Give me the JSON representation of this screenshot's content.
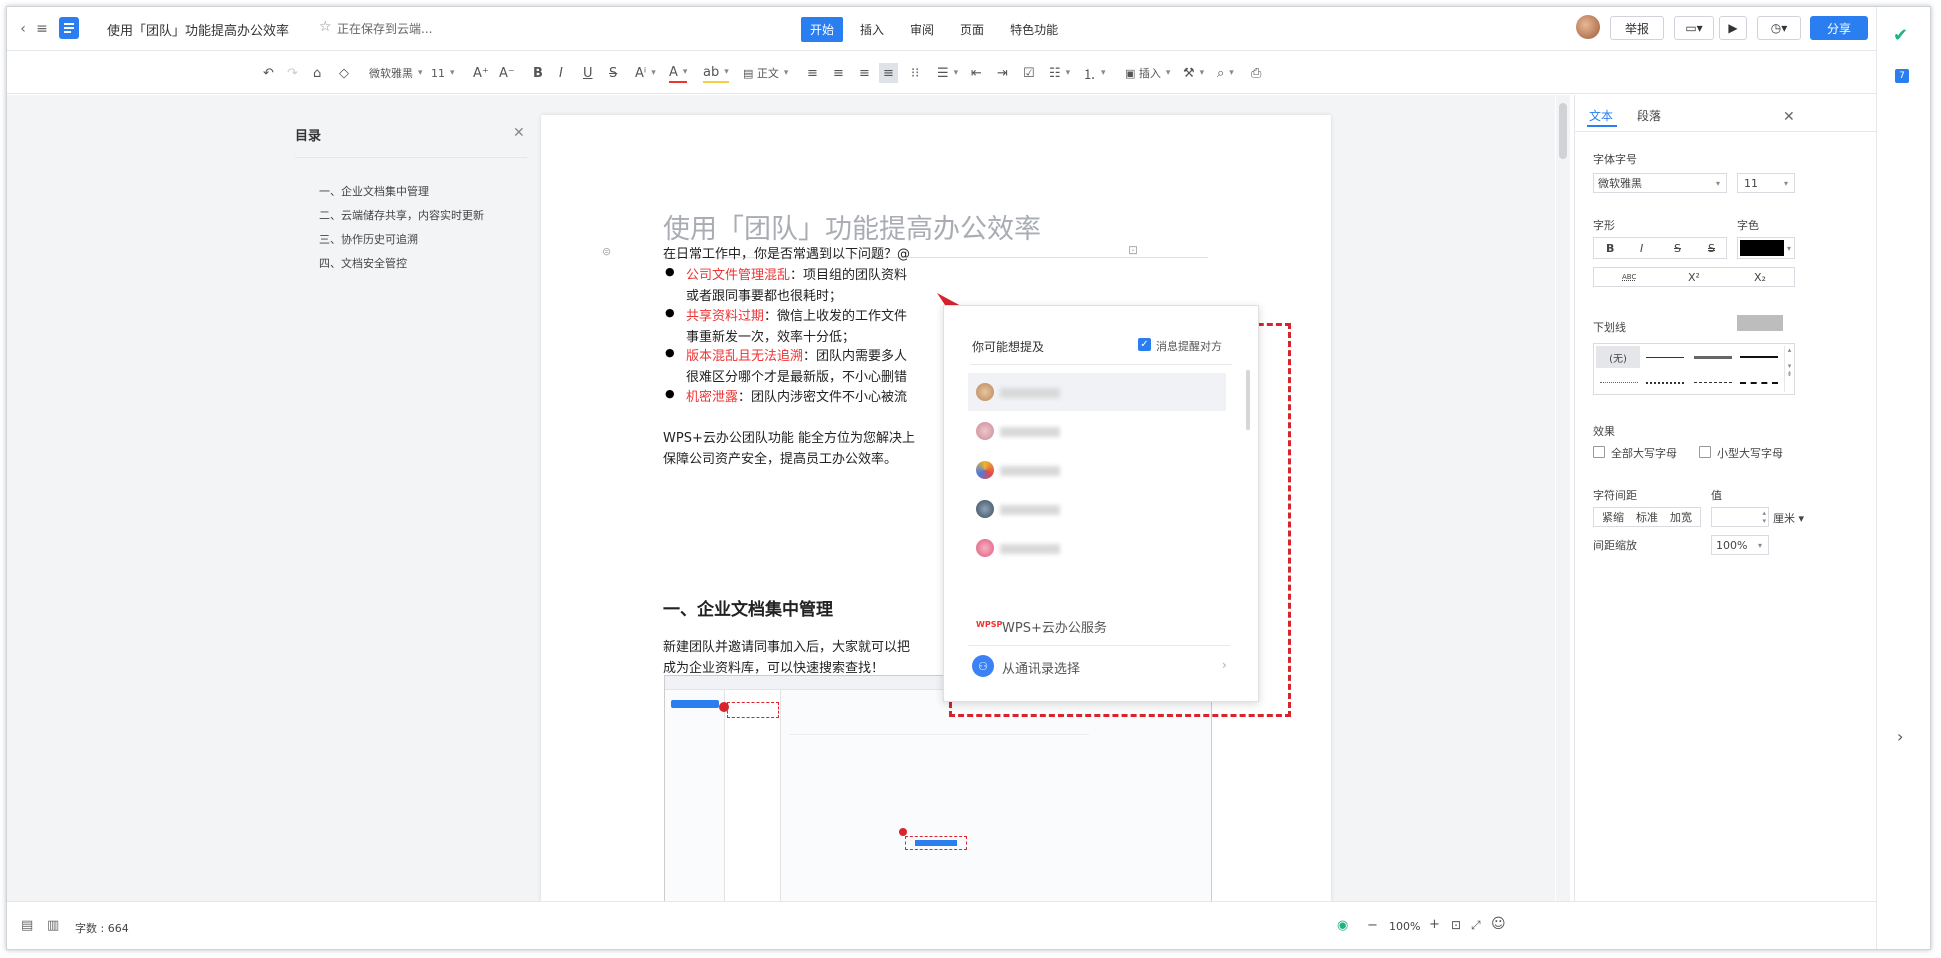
{
  "app": {
    "doc_title": "使用「团队」功能提高办公效率",
    "save_status": "正在保存到云端...",
    "menu_tabs": [
      "开始",
      "插入",
      "审阅",
      "页面",
      "特色功能"
    ],
    "report_label": "举报",
    "share_label": "分享"
  },
  "toolbar": {
    "font_name": "微软雅黑",
    "font_size": "11",
    "style": "正文",
    "insert_label": "插入",
    "colors": {
      "accent": "#2b7ef0",
      "font_color_bar": "#e33",
      "highlight_bar": "#f4d03f"
    }
  },
  "outline": {
    "title": "目录",
    "items": [
      "一、企业文档集中管理",
      "二、云端储存共享，内容实时更新",
      "三、协作历史可追溯",
      "四、文档安全管控"
    ]
  },
  "document": {
    "heading": "使用「团队」功能提高办公效率",
    "intro": "在日常工作中，你是否常遇到以下问题？@",
    "bullets": [
      {
        "label": "公司文件管理混乱",
        "text": "：项目组的团队资料",
        "cont": "或者跟同事要都也很耗时；"
      },
      {
        "label": "共享资料过期",
        "text": "：微信上收发的工作文件",
        "cont": "事重新发一次，效率十分低；"
      },
      {
        "label": "版本混乱且无法追溯",
        "text": "：团队内需要多人",
        "cont": "很难区分哪个才是最新版，不小心删错"
      },
      {
        "label": "机密泄露",
        "text": "：团队内涉密文件不小心被流",
        "cont": ""
      }
    ],
    "para1": "WPS+云办公团队功能 能全方位为您解决上",
    "para2": "保障公司资产安全，提高员工办公效率。",
    "section_heading": "一、企业文档集中管理",
    "para3": "新建团队并邀请同事加入后，大家就可以把",
    "para4": "成为企业资料库，可以快速搜索查找！"
  },
  "mention_popup": {
    "title": "你可能想提及",
    "notify_label": "消息提醒对方",
    "people_count": 5,
    "service_logo": "WPSP",
    "service_label": "WPS+云办公服务",
    "contacts_label": "从通讯录选择"
  },
  "right_panel": {
    "tabs": [
      "文本",
      "段落"
    ],
    "font_section": "字体字号",
    "font_name": "微软雅黑",
    "font_size": "11",
    "shape_label": "字形",
    "color_label": "字色",
    "style_buttons": [
      "B",
      "I",
      "S",
      "S"
    ],
    "abc_label": "ABC",
    "sup_label": "X²",
    "sub_label": "X₂",
    "underline_label": "下划线",
    "none_label": "(无)",
    "effect_label": "效果",
    "all_caps": "全部大写字母",
    "small_caps": "小型大写字母",
    "spacing_label": "字符间距",
    "value_label": "值",
    "spacing_options": [
      "紧缩",
      "标准",
      "加宽"
    ],
    "unit": "厘米",
    "scale_label": "间距缩放",
    "scale_value": "100%"
  },
  "status": {
    "word_count": "字数 : 664",
    "zoom": "100%"
  }
}
